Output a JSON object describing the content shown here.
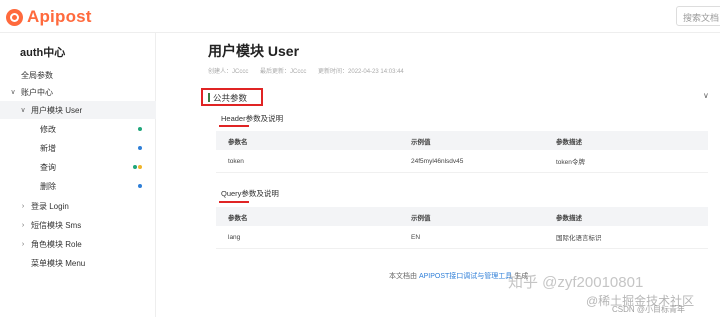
{
  "app": {
    "logo_text": "Apipost",
    "search_placeholder": "搜索文档"
  },
  "sidebar": {
    "project_title": "auth中心",
    "global_params": "全局参数",
    "items": [
      {
        "label": "账户中心",
        "chevron": "∨"
      },
      {
        "label": "用户模块 User",
        "chevron": "∨"
      },
      {
        "label": "修改",
        "dot_colors": [
          "#1fa67a"
        ]
      },
      {
        "label": "新增",
        "dot_colors": [
          "#2f7fd8"
        ]
      },
      {
        "label": "查询",
        "dot_colors": [
          "#1fa67a",
          "#f0b429"
        ]
      },
      {
        "label": "删除",
        "dot_colors": [
          "#2f7fd8"
        ]
      },
      {
        "label": "登录 Login",
        "chevron": "›"
      },
      {
        "label": "短信模块 Sms",
        "chevron": "›"
      },
      {
        "label": "角色模块 Role",
        "chevron": "›"
      },
      {
        "label": "菜单模块 Menu"
      }
    ]
  },
  "main": {
    "title": "用户模块 User",
    "meta": {
      "creator": "创建人：JCccc",
      "updater": "最后更新：JCccc",
      "updated": "更新时间：2022-04-23 14:03:44"
    },
    "section_title": "公共参数",
    "collapse_icon": "∨",
    "header_title": "Header参数及说明",
    "header_table": {
      "columns": [
        "参数名",
        "示例值",
        "参数描述"
      ],
      "rows": [
        [
          "token",
          "24f5myl46nlsdv45",
          "token令牌"
        ]
      ]
    },
    "query_title": "Query参数及说明",
    "query_table": {
      "columns": [
        "参数名",
        "示例值",
        "参数描述"
      ],
      "rows": [
        [
          "lang",
          "EN",
          "国际化语言标识"
        ]
      ]
    },
    "footer_prefix": "本文档由",
    "footer_link": "APIPOST接口调试与管理工具",
    "footer_suffix": "生成"
  },
  "watermark": {
    "line1": "知乎 @zyf20010801",
    "line2": "@稀土掘金技术社区",
    "line3": "CSDN @小目标青年"
  },
  "colors": {
    "brand": "#ff6a3d",
    "highlight": "#e02424",
    "link": "#2f7fd8",
    "section_bar": "#3a7d44"
  }
}
